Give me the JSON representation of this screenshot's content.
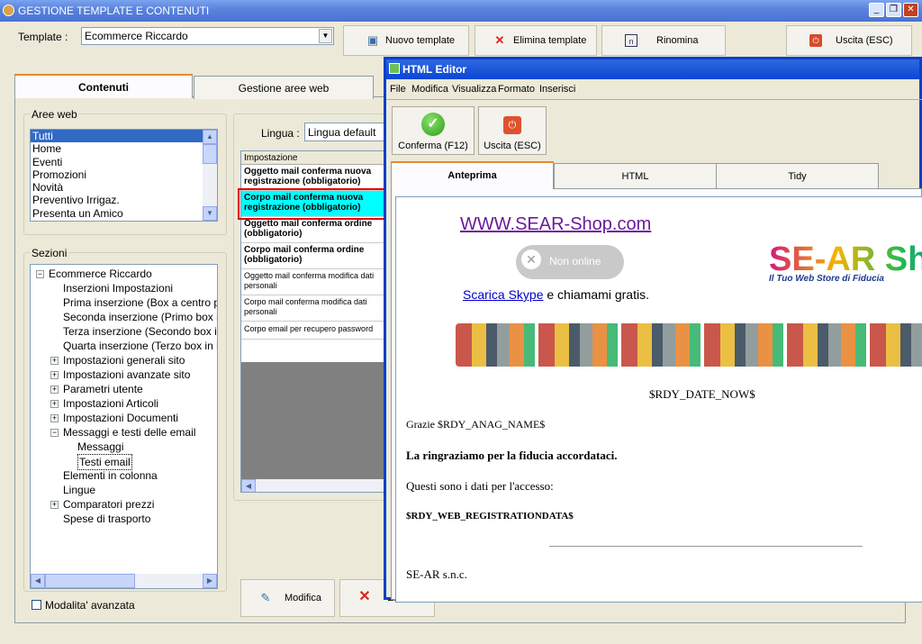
{
  "window": {
    "title": "GESTIONE TEMPLATE E CONTENUTI",
    "minimize": "_",
    "restore": "❐",
    "close": "✕"
  },
  "toolbar": {
    "template_label": "Template :",
    "template_value": "Ecommerce Riccardo",
    "new_label": "Nuovo template",
    "delete_label": "Elimina template",
    "rename_label": "Rinomina",
    "exit_label": "Uscita (ESC)"
  },
  "tabs": [
    "Contenuti",
    "Gestione aree web"
  ],
  "areas": {
    "label": "Aree web",
    "items": [
      "Tutti",
      "Home",
      "Eventi",
      "Promozioni",
      "Novità",
      "Preventivo Irrigaz.",
      "Presenta un Amico"
    ]
  },
  "sections": {
    "label": "Sezioni",
    "items": [
      "Ecommerce Riccardo",
      "Inserzioni Impostazioni",
      "Prima inserzione (Box a centro pa",
      "Seconda inserzione (Primo box i",
      "Terza inserzione (Secondo box i",
      "Quarta inserzione (Terzo box in b",
      "Impostazioni generali sito",
      "Impostazioni avanzate sito",
      "Parametri utente",
      "Impostazioni Articoli",
      "Impostazioni Documenti",
      "Messaggi e testi delle email",
      "Messaggi",
      "Testi email",
      "Elementi in colonna",
      "Lingue",
      "Comparatori prezzi",
      "Spese di trasporto"
    ]
  },
  "advanced_mode": "Modalita' avanzata",
  "language": {
    "label": "Lingua :",
    "value": "Lingua default"
  },
  "settings": {
    "header": "Impostazione",
    "rows": [
      "Oggetto mail conferma nuova registrazione (obbligatorio)",
      "Corpo mail conferma nuova registrazione (obbligatorio)",
      "Oggetto mail conferma ordine (obbligatorio)",
      "Corpo mail conferma ordine (obbligatorio)",
      "Oggetto mail conferma modifica dati personali",
      "Corpo mail conferma modifica dati personali",
      "Corpo email per recupero password"
    ]
  },
  "actions": {
    "edit": "Modifica",
    "delete": "Elimina"
  },
  "editor": {
    "title": "HTML Editor",
    "menu": [
      "File",
      "Modifica",
      "Visualizza",
      "Formato",
      "Inserisci"
    ],
    "confirm": "Conferma (F12)",
    "exit": "Uscita (ESC)",
    "tabs": [
      "Anteprima",
      "HTML",
      "Tidy"
    ],
    "preview": {
      "site_link": "WWW.SEAR-Shop.com",
      "skype_status": "Non online",
      "skype_link": "Scarica Skype",
      "skype_text": " e chiamami gratis.",
      "logo": "SE-AR Shop",
      "logo_tagline": "Il Tuo Web Store di Fiducia",
      "date": "$RDY_DATE_NOW$",
      "greeting": "Grazie $RDY_ANAG_NAME$",
      "thanks": "La ringraziamo per la fiducia accordataci.",
      "access": "Questi sono i dati per l'accesso:",
      "reg_data": "$RDY_WEB_REGISTRATIONDATA$",
      "company": "SE-AR s.n.c."
    }
  },
  "colors": {
    "accent": "#316ac5",
    "highlight": "#00ffff",
    "marker": "#e00000"
  }
}
